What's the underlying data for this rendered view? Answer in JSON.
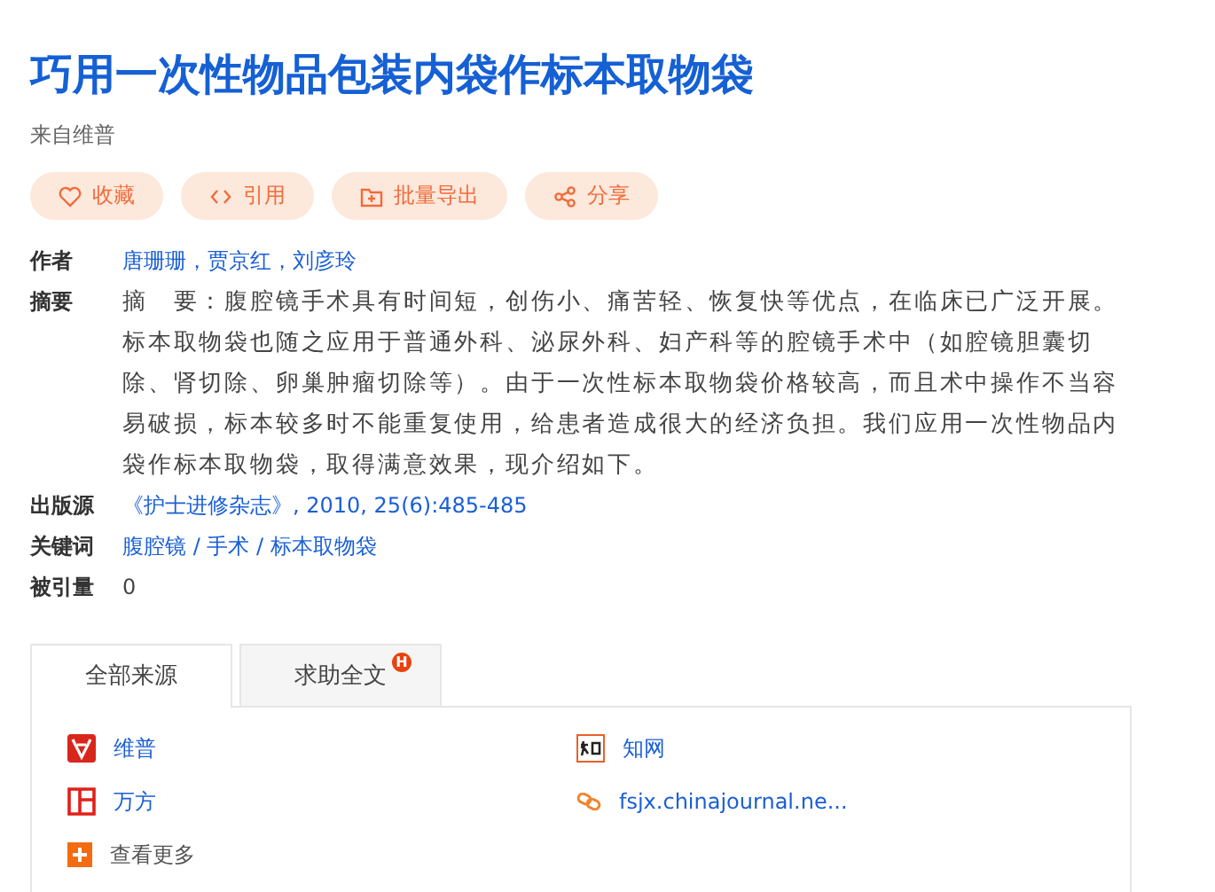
{
  "title": "巧用一次性物品包装内袋作标本取物袋",
  "origin": "来自维普",
  "actions": [
    {
      "label": "收藏"
    },
    {
      "label": "引用"
    },
    {
      "label": "批量导出"
    },
    {
      "label": "分享"
    }
  ],
  "meta": [
    {
      "kind": "links",
      "label": "作者",
      "items": [
        "唐珊珊",
        "贾京红",
        "刘彦玲"
      ],
      "sep": "，"
    },
    {
      "kind": "text",
      "label": "摘要",
      "text": "摘　要：腹腔镜手术具有时间短，创伤小、痛苦轻、恢复快等优点，在临床已广泛开展。标本取物袋也随之应用于普通外科、泌尿外科、妇产科等的腔镜手术中（如腔镜胆囊切除、肾切除、卵巢肿瘤切除等）。由于一次性标本取物袋价格较高，而且术中操作不当容易破损，标本较多时不能重复使用，给患者造成很大的经济负担。我们应用一次性物品内袋作标本取物袋，取得满意效果，现介绍如下。"
    },
    {
      "kind": "links",
      "label": "出版源",
      "items": [
        "《护士进修杂志》, 2010, 25(6):485-485"
      ]
    },
    {
      "kind": "links",
      "label": "关键词",
      "items": [
        "腹腔镜",
        "手术",
        "标本取物袋"
      ],
      "sep": " / "
    },
    {
      "kind": "text",
      "label": "被引量",
      "text": "0"
    }
  ],
  "tabs": [
    {
      "label": "全部来源",
      "selected": true
    },
    {
      "label": "求助全文",
      "selected": false,
      "badge": "H"
    }
  ],
  "sources": [
    {
      "label": "维普",
      "kind": "link"
    },
    {
      "label": "知网",
      "kind": "link"
    },
    {
      "label": "万方",
      "kind": "link"
    },
    {
      "label": "fsjx.chinajournal.ne...",
      "kind": "link"
    },
    {
      "label": "查看更多",
      "kind": "more"
    }
  ]
}
